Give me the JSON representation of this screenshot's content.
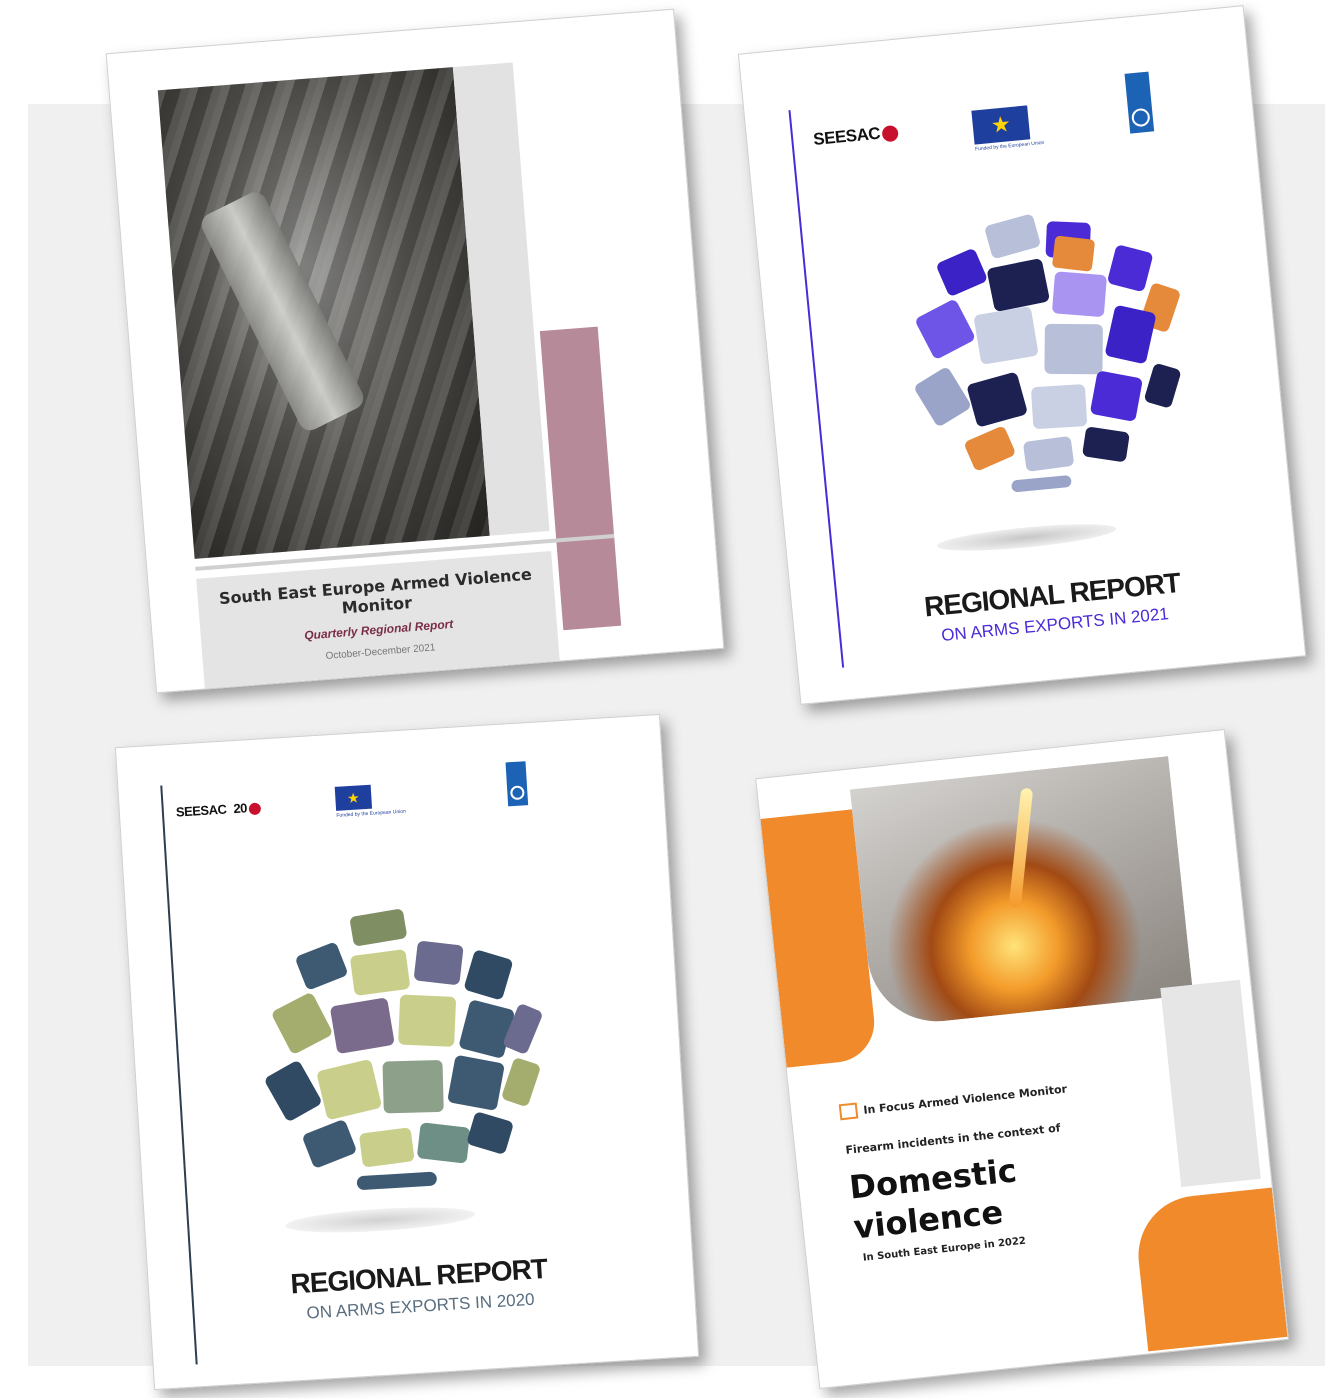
{
  "covers": {
    "quarterly": {
      "title": "South East Europe Armed Violence Monitor",
      "subtitle": "Quarterly Regional Report",
      "date": "October-December 2021"
    },
    "exports_2021": {
      "org_logo": "SEESAC",
      "eu_caption": "Funded by the European Union",
      "undp_logo": "UNDP",
      "title": "REGIONAL REPORT",
      "subtitle": "ON ARMS EXPORTS IN 2021",
      "accent_color": "#4b2bd6"
    },
    "exports_2020": {
      "org_logo": "SEESAC",
      "anniversary_mark": "20",
      "eu_caption": "Funded by the European Union",
      "undp_logo": "UNDP",
      "title": "REGIONAL REPORT",
      "subtitle": "ON ARMS EXPORTS IN 2020"
    },
    "domestic_violence": {
      "kicker": "In Focus Armed Violence Monitor",
      "lead": "Firearm incidents in the context of",
      "headline_line1": "Domestic",
      "headline_line2": "violence",
      "footer": "In South East Europe in 2022",
      "accent_color": "#f08a2b"
    }
  }
}
